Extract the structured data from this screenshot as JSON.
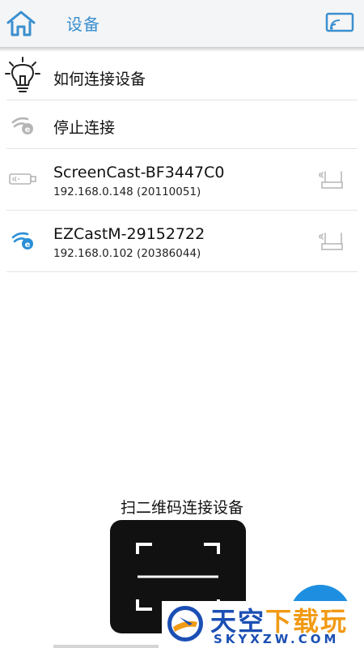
{
  "header": {
    "title": "设备",
    "home_icon": "home-icon",
    "cast_icon": "screen-cast-icon"
  },
  "list": {
    "how_to_connect": {
      "label": "如何连接设备",
      "icon": "lightbulb-icon"
    },
    "stop_connect": {
      "label": "停止连接",
      "icon": "ezcast-wifi-gray-icon"
    },
    "devices": [
      {
        "name": "ScreenCast-BF3447C0",
        "detail": "192.168.0.148 (20110051)",
        "icon": "usb-dongle-icon",
        "router_icon": "router-icon"
      },
      {
        "name": "EZCastM-29152722",
        "detail": "192.168.0.102 (20386044)",
        "icon": "ezcast-wifi-blue-icon",
        "router_icon": "router-icon"
      }
    ]
  },
  "qr": {
    "label": "扫二维码连接设备",
    "icon": "qr-scan-icon"
  },
  "watermark": {
    "main_a": "天空",
    "main_b": "下载玩",
    "sub": "SKYXZW.COM"
  },
  "colors": {
    "accent": "#3a8fcf",
    "fab": "#1e8fe0",
    "watermark_blue": "#1b4fb4",
    "watermark_orange": "#f19a14"
  }
}
